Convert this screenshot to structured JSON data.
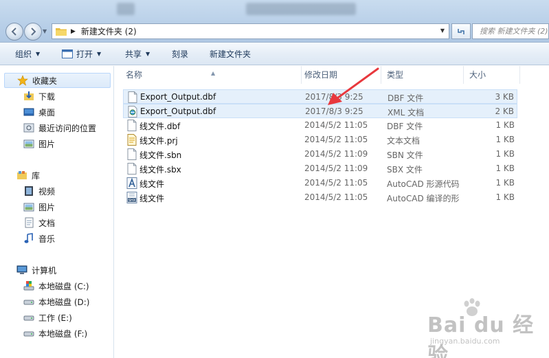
{
  "address": {
    "path": "新建文件夹 (2)"
  },
  "search": {
    "placeholder": "搜索 新建文件夹 (2)"
  },
  "toolbar": {
    "organize": "组织",
    "open": "打开",
    "share": "共享",
    "burn": "刻录",
    "new_folder": "新建文件夹"
  },
  "sidebar": {
    "favorites": {
      "label": "收藏夹",
      "items": [
        "下载",
        "桌面",
        "最近访问的位置",
        "图片"
      ]
    },
    "libraries": {
      "label": "库",
      "items": [
        "视频",
        "图片",
        "文档",
        "音乐"
      ]
    },
    "computer": {
      "label": "计算机",
      "items": [
        "本地磁盘 (C:)",
        "本地磁盘 (D:)",
        "工作 (E:)",
        "本地磁盘 (F:)"
      ]
    }
  },
  "columns": {
    "name": "名称",
    "date": "修改日期",
    "type": "类型",
    "size": "大小"
  },
  "files": [
    {
      "name": "Export_Output.dbf",
      "date": "2017/8/3 9:25",
      "type": "DBF 文件",
      "size": "3 KB",
      "icon": "blank-file-icon"
    },
    {
      "name": "Export_Output.dbf",
      "date": "2017/8/3 9:25",
      "type": "XML 文档",
      "size": "2 KB",
      "icon": "xml-file-icon"
    },
    {
      "name": "线文件.dbf",
      "date": "2014/5/2 11:05",
      "type": "DBF 文件",
      "size": "1 KB",
      "icon": "blank-file-icon"
    },
    {
      "name": "线文件.prj",
      "date": "2014/5/2 11:05",
      "type": "文本文档",
      "size": "1 KB",
      "icon": "text-file-icon"
    },
    {
      "name": "线文件.sbn",
      "date": "2014/5/2 11:09",
      "type": "SBN 文件",
      "size": "1 KB",
      "icon": "blank-file-icon"
    },
    {
      "name": "线文件.sbx",
      "date": "2014/5/2 11:09",
      "type": "SBX 文件",
      "size": "1 KB",
      "icon": "blank-file-icon"
    },
    {
      "name": "线文件",
      "date": "2014/5/2 11:05",
      "type": "AutoCAD 形源代码",
      "size": "1 KB",
      "icon": "autocad-shape-icon"
    },
    {
      "name": "线文件",
      "date": "2014/5/2 11:05",
      "type": "AutoCAD 编译的形",
      "size": "1 KB",
      "icon": "shx-file-icon"
    }
  ],
  "watermark": {
    "brand": "Bai du 经验",
    "url": "jingyan.baidu.com"
  },
  "colors": {
    "accent_arrow": "#e8383d",
    "selection": "#dceafa"
  }
}
